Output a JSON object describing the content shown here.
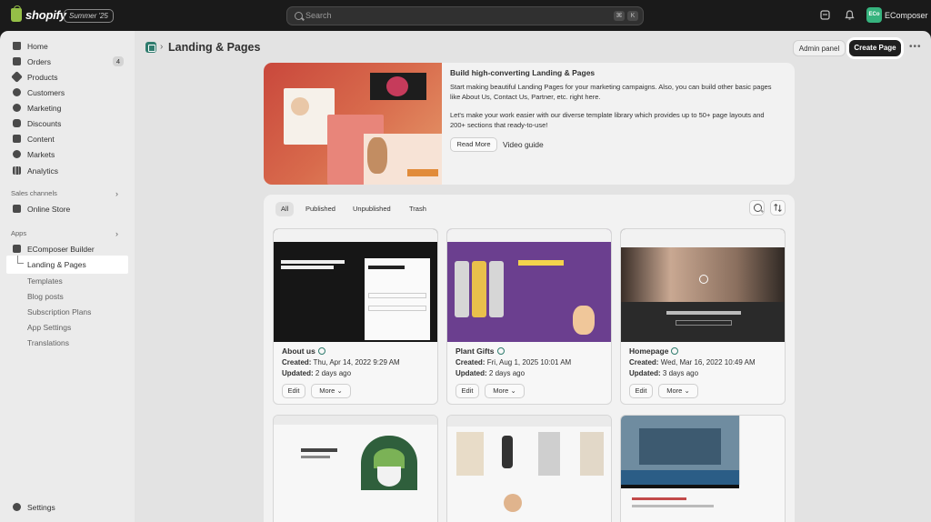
{
  "topbar": {
    "brand": "shopify",
    "season_badge": "Summer '25",
    "search_placeholder": "Search",
    "kbd1": "⌘",
    "kbd2": "K",
    "store_avatar": "ECo",
    "store_name": "EComposer"
  },
  "sidebar": {
    "items": [
      {
        "label": "Home",
        "icon": "home-icon"
      },
      {
        "label": "Orders",
        "icon": "orders-icon",
        "badge": "4"
      },
      {
        "label": "Products",
        "icon": "tag-icon"
      },
      {
        "label": "Customers",
        "icon": "person-icon"
      },
      {
        "label": "Marketing",
        "icon": "target-icon"
      },
      {
        "label": "Discounts",
        "icon": "discount-icon"
      },
      {
        "label": "Content",
        "icon": "content-icon"
      },
      {
        "label": "Markets",
        "icon": "globe-icon"
      },
      {
        "label": "Analytics",
        "icon": "chart-icon"
      }
    ],
    "sales_channels_title": "Sales channels",
    "online_store": "Online Store",
    "apps_title": "Apps",
    "app_name": "EComposer Builder",
    "app_sub": [
      "Landing & Pages",
      "Templates",
      "Blog posts",
      "Subscription Plans",
      "App Settings",
      "Translations"
    ],
    "settings": "Settings"
  },
  "header": {
    "title": "Landing & Pages",
    "admin_panel": "Admin panel",
    "create_page": "Create Page"
  },
  "hero": {
    "title": "Build high-converting Landing & Pages",
    "p1": "Start making beautiful Landing Pages for your marketing campaigns. Also, you can build other basic pages like About Us, Contact Us, Partner, etc. right here.",
    "p2": "Let's make your work easier with our diverse template library which provides up to 50+ page layouts and 200+ sections that ready-to-use!",
    "read_more": "Read More",
    "video_guide": "Video guide"
  },
  "tabs": [
    "All",
    "Published",
    "Unpublished",
    "Trash"
  ],
  "pages": [
    {
      "title": "About us",
      "created": "Thu, Apr 14, 2022 9:29 AM",
      "updated": "2 days ago"
    },
    {
      "title": "Plant Gifts",
      "created": "Fri, Aug 1, 2025 10:01 AM",
      "updated": "2 days ago"
    },
    {
      "title": "Homepage",
      "created": "Wed, Mar 16, 2022 10:49 AM",
      "updated": "3 days ago"
    }
  ],
  "labels": {
    "created": "Created:",
    "updated": "Updated:",
    "edit": "Edit",
    "more": "More"
  }
}
